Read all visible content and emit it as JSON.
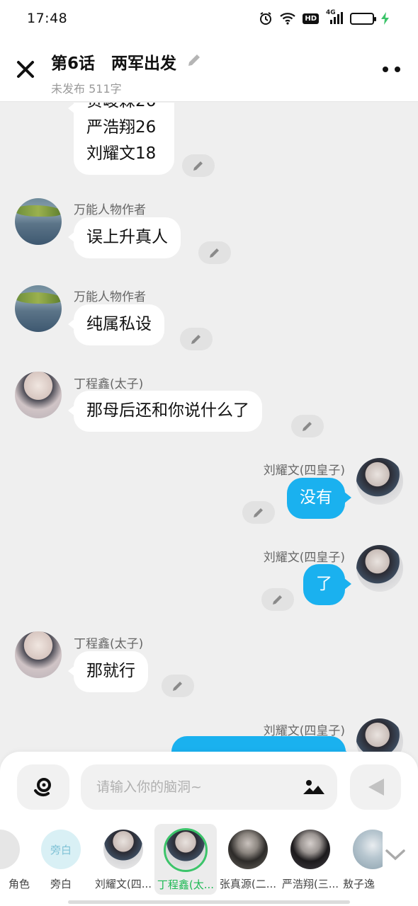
{
  "status_bar": {
    "time": "17:48",
    "icons": [
      "alarm-icon",
      "wifi-icon",
      "hd-icon",
      "signal-4g-icon",
      "battery-icon",
      "charging-icon"
    ],
    "hd_label": "HD",
    "network_label": "4G",
    "battery_level": 0.75
  },
  "header": {
    "title": "第6话　两军出发",
    "status": "未发布 511字"
  },
  "messages": [
    {
      "speaker": "",
      "lines": [
        "贺峻霖26",
        "严浩翔26",
        "刘耀文18"
      ],
      "side": "left"
    },
    {
      "speaker": "万能人物作者",
      "text": "误上升真人",
      "side": "left"
    },
    {
      "speaker": "万能人物作者",
      "text": "纯属私设",
      "side": "left"
    },
    {
      "speaker": "丁程鑫(太子)",
      "text": "那母后还和你说什么了",
      "side": "left"
    },
    {
      "speaker": "刘耀文(四皇子)",
      "text": "没有",
      "side": "right"
    },
    {
      "speaker": "刘耀文(四皇子)",
      "text": "了",
      "side": "right"
    },
    {
      "speaker": "丁程鑫(太子)",
      "text": "那就行",
      "side": "left"
    },
    {
      "speaker": "刘耀文(四皇子)",
      "text": "",
      "side": "right"
    }
  ],
  "composer": {
    "placeholder": "请输入你的脑洞~",
    "value": ""
  },
  "roles": [
    {
      "name": "角色",
      "active": false
    },
    {
      "name": "旁白",
      "avatar_text": "旁白",
      "active": false
    },
    {
      "name": "刘耀文(四...",
      "active": false
    },
    {
      "name": "丁程鑫(太...",
      "active": true
    },
    {
      "name": "张真源(二...",
      "active": false
    },
    {
      "name": "严浩翔(三...",
      "active": false
    },
    {
      "name": "敖子逸",
      "active": false
    }
  ],
  "colors": {
    "accent_blue": "#1ab1ef",
    "active_green": "#3cc46a",
    "background": "#efefef"
  }
}
